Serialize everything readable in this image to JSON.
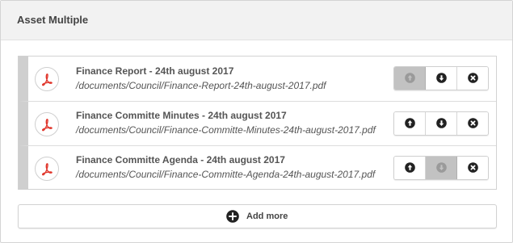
{
  "panel": {
    "title": "Asset Multiple"
  },
  "colors": {
    "pdf_icon": "#e0352b",
    "button_icon": "#222222",
    "disabled_bg": "#c2c2c2"
  },
  "assets": [
    {
      "title": "Finance Report - 24th august 2017",
      "path": "/documents/Council/Finance-Report-24th-august-2017.pdf",
      "icon": "pdf-icon",
      "move_up_enabled": false,
      "move_down_enabled": true
    },
    {
      "title": "Finance Committe Minutes - 24th august 2017",
      "path": "/documents/Council/Finance-Committe-Minutes-24th-august-2017.pdf",
      "icon": "pdf-icon",
      "move_up_enabled": true,
      "move_down_enabled": true
    },
    {
      "title": "Finance Committe Agenda - 24th august 2017",
      "path": "/documents/Council/Finance-Committe-Agenda-24th-august-2017.pdf",
      "icon": "pdf-icon",
      "move_up_enabled": true,
      "move_down_enabled": false
    }
  ],
  "add_more": {
    "label": "Add more",
    "icon": "plus-circle-icon"
  }
}
